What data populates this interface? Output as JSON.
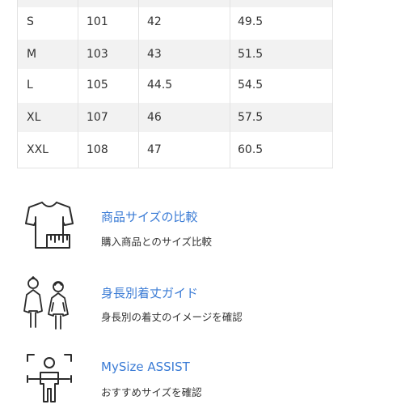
{
  "size_table": {
    "rows": [
      {
        "size": "S",
        "c1": "101",
        "c2": "42",
        "c3": "49.5"
      },
      {
        "size": "M",
        "c1": "103",
        "c2": "43",
        "c3": "51.5"
      },
      {
        "size": "L",
        "c1": "105",
        "c2": "44.5",
        "c3": "54.5"
      },
      {
        "size": "XL",
        "c1": "107",
        "c2": "46",
        "c3": "57.5"
      },
      {
        "size": "XXL",
        "c1": "108",
        "c2": "47",
        "c3": "60.5"
      }
    ]
  },
  "links": [
    {
      "title": "商品サイズの比較",
      "desc": "購入商品とのサイズ比較",
      "icon": "tshirt-ruler-icon"
    },
    {
      "title": "身長別着丈ガイド",
      "desc": "身長別の着丈のイメージを確認",
      "icon": "people-height-icon"
    },
    {
      "title": "MySize ASSIST",
      "desc": "おすすめサイズを確認",
      "icon": "body-scan-icon"
    }
  ],
  "colors": {
    "link": "#3a7bd5",
    "row_shade": "#f2f2f2",
    "border": "#e2e2e2"
  }
}
